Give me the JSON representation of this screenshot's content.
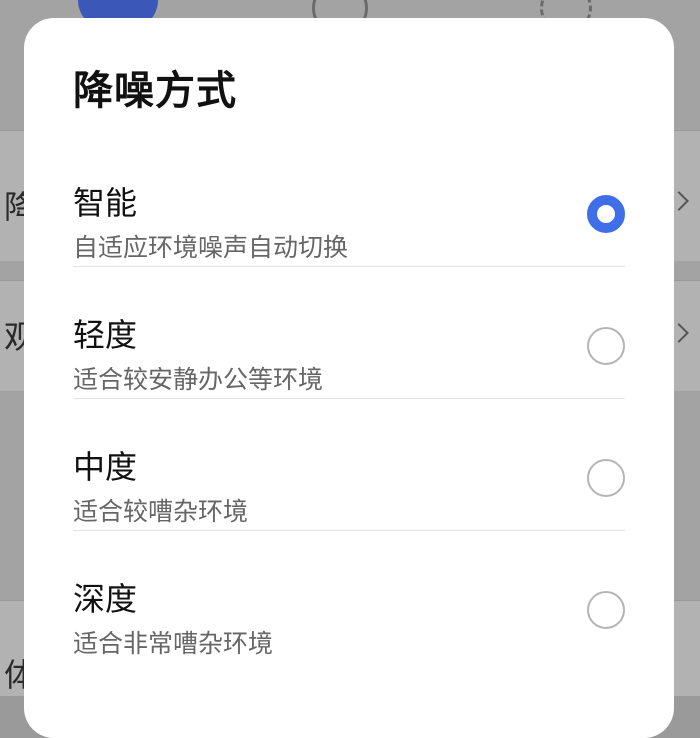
{
  "background": {
    "row_chars": [
      "降",
      "观",
      "体"
    ]
  },
  "dialog": {
    "title": "降噪方式",
    "options": [
      {
        "label": "智能",
        "description": "自适应环境噪声自动切换",
        "selected": true
      },
      {
        "label": "轻度",
        "description": "适合较安静办公等环境",
        "selected": false
      },
      {
        "label": "中度",
        "description": "适合较嘈杂环境",
        "selected": false
      },
      {
        "label": "深度",
        "description": "适合非常嘈杂环境",
        "selected": false
      }
    ],
    "accent_color": "#3f6fe8"
  }
}
